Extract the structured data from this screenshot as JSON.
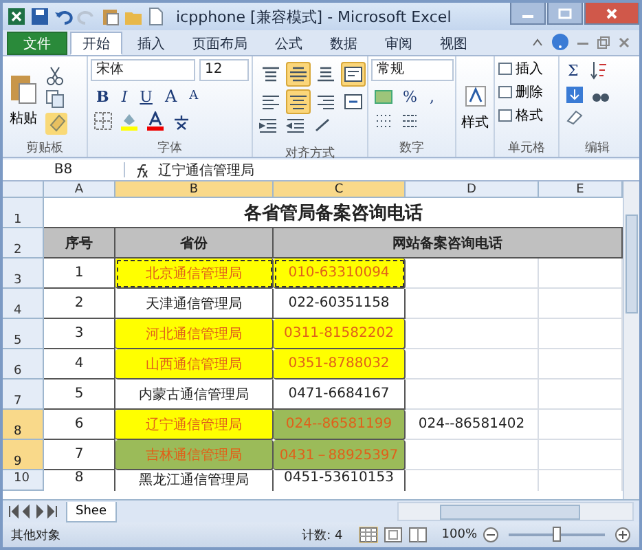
{
  "window": {
    "title": "icpphone  [兼容模式] - Microsoft Excel"
  },
  "ribbon_tabs": [
    {
      "label": "文件",
      "kind": "file",
      "selected": false
    },
    {
      "label": "开始",
      "kind": "tab",
      "selected": true
    },
    {
      "label": "插入",
      "kind": "tab",
      "selected": false
    },
    {
      "label": "页面布局",
      "kind": "tab",
      "selected": false
    },
    {
      "label": "公式",
      "kind": "tab",
      "selected": false
    },
    {
      "label": "数据",
      "kind": "tab",
      "selected": false
    },
    {
      "label": "审阅",
      "kind": "tab",
      "selected": false
    },
    {
      "label": "视图",
      "kind": "tab",
      "selected": false
    }
  ],
  "clipboard": {
    "paste": "粘贴",
    "label": "剪贴板"
  },
  "font": {
    "name": "宋体",
    "size": "12",
    "styles": [
      "B",
      "I",
      "U"
    ],
    "grow": "A",
    "shrink": "A",
    "label": "字体"
  },
  "alignment": {
    "buttons": [
      {
        "kind": "top",
        "selected": false
      },
      {
        "kind": "middle",
        "selected": true
      },
      {
        "kind": "bottom",
        "selected": false
      },
      {
        "kind": "wrap",
        "selected": true
      },
      {
        "kind": "left",
        "selected": false
      },
      {
        "kind": "center",
        "selected": true
      },
      {
        "kind": "right",
        "selected": false
      },
      {
        "kind": "merge",
        "selected": false
      }
    ],
    "label": "对齐方式"
  },
  "number": {
    "format": "常规",
    "percent": "%",
    "comma": ",",
    "label": "数字"
  },
  "styles": {
    "button": "样式"
  },
  "cells": {
    "items": [
      "插入",
      "删除",
      "格式"
    ],
    "label": "单元格"
  },
  "editing": {
    "sum": "Σ",
    "label": "编辑"
  },
  "formula_bar": {
    "name_box": "B8",
    "value": "辽宁通信管理局"
  },
  "columns": [
    {
      "label": "A",
      "selected": false
    },
    {
      "label": "B",
      "selected": true
    },
    {
      "label": "C",
      "selected": true
    },
    {
      "label": "D",
      "selected": false
    },
    {
      "label": "E",
      "selected": false
    }
  ],
  "title_row": "1",
  "header_row": "2",
  "sheet_title": "各省管局备案咨询电话",
  "headers": {
    "seq": "序号",
    "province": "省份",
    "phone": "网站备案咨询电话"
  },
  "rows": [
    {
      "row": "3",
      "selected": false,
      "seq": "1",
      "province": {
        "text": "北京通信管理局",
        "color": "#ffff00",
        "marquee": true
      },
      "phone": {
        "text": "010-63310094",
        "color": "#ffff00",
        "marquee": true
      }
    },
    {
      "row": "4",
      "selected": false,
      "seq": "2",
      "province": {
        "text": "天津通信管理局"
      },
      "phone": {
        "text": "022-60351158"
      }
    },
    {
      "row": "5",
      "selected": false,
      "seq": "3",
      "province": {
        "text": "河北通信管理局",
        "color": "#ffff00"
      },
      "phone": {
        "text": "0311-81582202",
        "color": "#ffff00"
      }
    },
    {
      "row": "6",
      "selected": false,
      "seq": "4",
      "province": {
        "text": "山西通信管理局",
        "color": "#ffff00"
      },
      "phone": {
        "text": "0351-8788032",
        "color": "#ffff00"
      }
    },
    {
      "row": "7",
      "selected": false,
      "seq": "5",
      "province": {
        "text": "内蒙古通信管理局"
      },
      "phone": {
        "text": "0471-6684167"
      }
    },
    {
      "row": "8",
      "selected": true,
      "seq": "6",
      "province": {
        "text": "辽宁通信管理局",
        "color": "#ffff00"
      },
      "phone": {
        "text": "024--86581199",
        "color": "#9bbb59"
      },
      "extra": "024--86581402"
    },
    {
      "row": "9",
      "selected": true,
      "seq": "7",
      "province": {
        "text": "吉林通信管理局",
        "color": "#9bbb59"
      },
      "phone": {
        "text": "0431－88925397",
        "color": "#9bbb59"
      }
    },
    {
      "row": "10",
      "selected": false,
      "seq": "8",
      "province": {
        "text": "黑龙江通信管理局"
      },
      "phone": {
        "text": "0451-53610153"
      }
    }
  ],
  "sheet_tabs": [
    {
      "label": "Shee",
      "selected": true
    }
  ],
  "status_bar": {
    "message": "其他对象",
    "count": "计数: 4",
    "zoom": "100%",
    "zoom_slider": {
      "level": 0.5
    }
  }
}
